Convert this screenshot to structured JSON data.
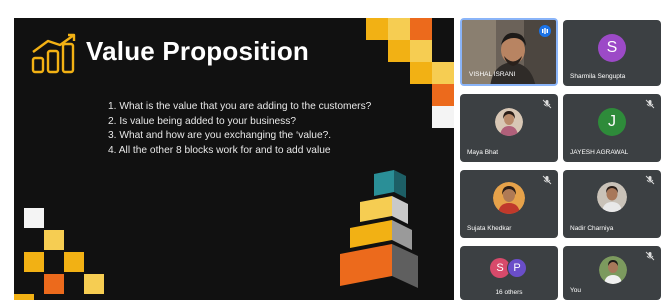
{
  "slide": {
    "title": "Value Proposition",
    "points": [
      "1. What is the value that you are adding to the customers?",
      "2. Is value being added to your business?",
      "3. What and how are you exchanging the ‘value?.",
      "4. All the other 8 blocks work for and to add value"
    ]
  },
  "participants": [
    {
      "name": "VISHAL ISRANI",
      "type": "video",
      "speaking": true
    },
    {
      "name": "Sharmila Sengupta",
      "type": "initial",
      "initial": "S",
      "color": "#9c4ac7",
      "muted": true
    },
    {
      "name": "Maya Bhat",
      "type": "photo",
      "muted": true
    },
    {
      "name": "JAYESH AGRAWAL",
      "type": "initial",
      "initial": "J",
      "color": "#2e8b3a",
      "muted": true
    },
    {
      "name": "Sujata Khedkar",
      "type": "photo",
      "muted": true
    },
    {
      "name": "Nadir Charniya",
      "type": "photo",
      "muted": true
    },
    {
      "name": "16 others",
      "type": "group",
      "initials": [
        "S",
        "P"
      ],
      "colors": [
        "#d84a6b",
        "#6a4ec9"
      ]
    },
    {
      "name": "You",
      "type": "photo",
      "muted": true
    }
  ],
  "colors": {
    "slide_bg": "#111111",
    "accent_yellow": "#f2b114",
    "accent_orange": "#ec6a1c",
    "tile_bg": "#3c4043",
    "speaking_border": "#8ab4f8"
  },
  "icons": {
    "mic_off": "mic-off-icon",
    "speaking": "speaking-indicator-icon",
    "logo": "growth-chart-logo-icon"
  }
}
